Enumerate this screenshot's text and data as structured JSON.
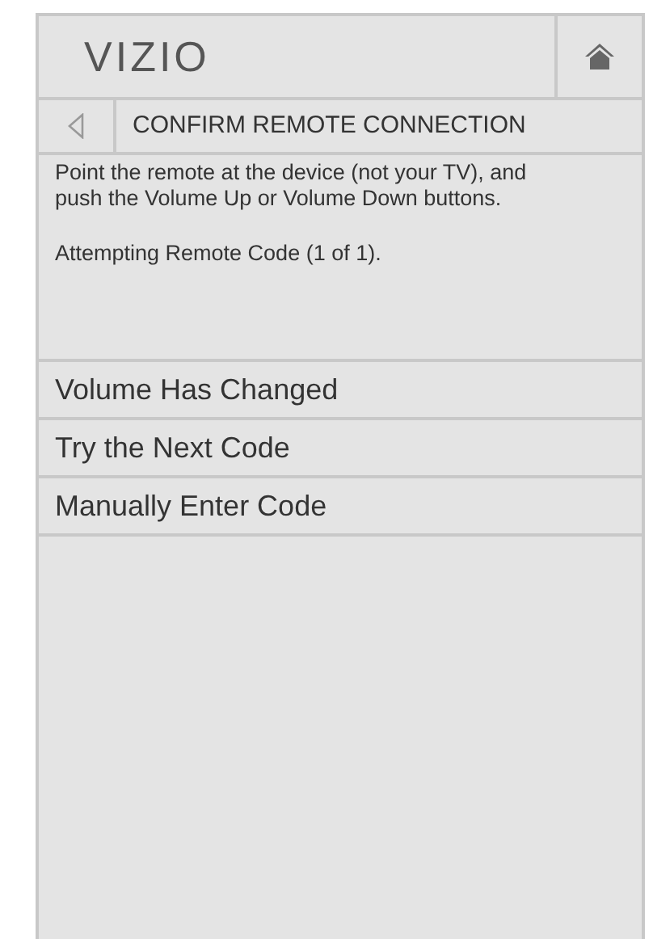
{
  "header": {
    "logo": "VIZIO"
  },
  "title_bar": {
    "title": "CONFIRM REMOTE CONNECTION"
  },
  "description": [
    "Point the remote at the device (not your TV), and push the Volume Up or Volume Down buttons.",
    "Attempting Remote Code (1 of 1)."
  ],
  "menu_items": [
    {
      "label": "Volume Has Changed"
    },
    {
      "label": "Try the Next Code"
    },
    {
      "label": "Manually Enter Code"
    }
  ]
}
